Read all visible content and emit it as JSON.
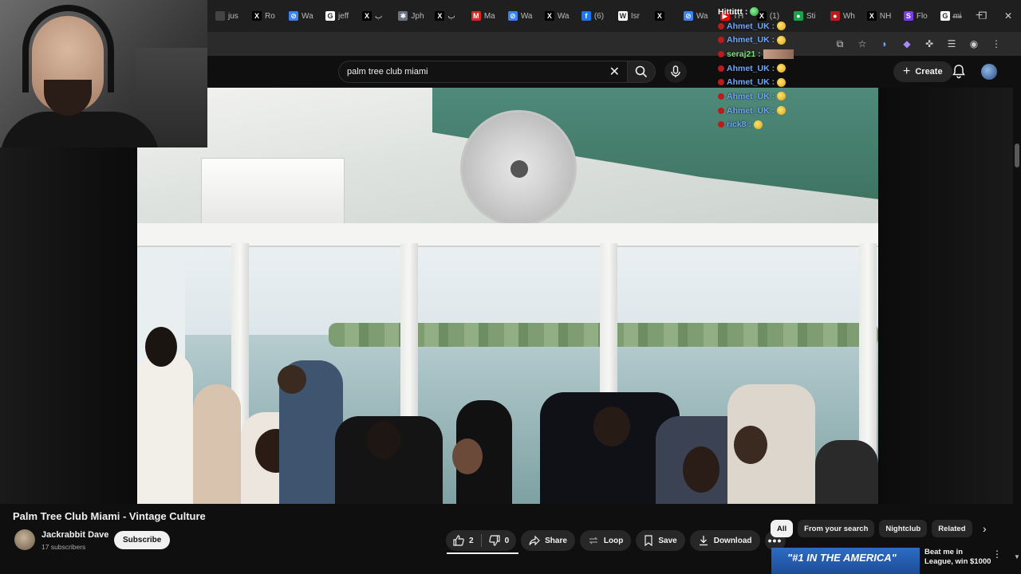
{
  "browser": {
    "tabs": [
      {
        "label": "jus",
        "icon": "page-icon",
        "color": "#444444",
        "glyph": ""
      },
      {
        "label": "Ro",
        "icon": "x-icon",
        "color": "#000000",
        "glyph": "X"
      },
      {
        "label": "Wa",
        "icon": "grok-icon",
        "color": "#3b82f6",
        "glyph": "⊘"
      },
      {
        "label": "jeff",
        "icon": "google-icon",
        "color": "#ffffff",
        "glyph": "G"
      },
      {
        "label": "ب",
        "icon": "x-icon",
        "color": "#000000",
        "glyph": "X"
      },
      {
        "label": "Jph",
        "icon": "grok-icon",
        "color": "#6b7280",
        "glyph": "✱"
      },
      {
        "label": "ب",
        "icon": "x-icon",
        "color": "#000000",
        "glyph": "X"
      },
      {
        "label": "Ma",
        "icon": "gmail-icon",
        "color": "#dc2626",
        "glyph": "M"
      },
      {
        "label": "Wa",
        "icon": "grok-icon",
        "color": "#3b82f6",
        "glyph": "⊘"
      },
      {
        "label": "Wa",
        "icon": "x-icon",
        "color": "#000000",
        "glyph": "X"
      },
      {
        "label": "(6)",
        "icon": "facebook-icon",
        "color": "#1877f2",
        "glyph": "f"
      },
      {
        "label": "Isr",
        "icon": "wikipedia-icon",
        "color": "#ffffff",
        "glyph": "W"
      },
      {
        "label": "",
        "icon": "x-icon",
        "color": "#000000",
        "glyph": "X"
      },
      {
        "label": "Wa",
        "icon": "grok-icon",
        "color": "#3b82f6",
        "glyph": "⊘"
      },
      {
        "label": "TH",
        "icon": "youtube-icon",
        "color": "#ff0000",
        "glyph": "▶"
      },
      {
        "label": "(1)",
        "icon": "x-icon",
        "color": "#000000",
        "glyph": "X"
      },
      {
        "label": "Sti",
        "icon": "globe-icon",
        "color": "#16a34a",
        "glyph": "●"
      },
      {
        "label": "Wh",
        "icon": "globe-icon",
        "color": "#b91c1c",
        "glyph": "●"
      },
      {
        "label": "NH",
        "icon": "x-icon",
        "color": "#000000",
        "glyph": "X"
      },
      {
        "label": "Flo",
        "icon": "s-icon",
        "color": "#7c3aed",
        "glyph": "S"
      },
      {
        "label": "mi",
        "icon": "google-icon",
        "color": "#ffffff",
        "glyph": "G"
      }
    ],
    "new_tab": "+"
  },
  "youtube": {
    "search_value": "palm tree club miami",
    "create_label": "Create"
  },
  "chat": [
    {
      "name": "Hittittt :",
      "style": "white",
      "emote": "green"
    },
    {
      "name": "Ahmet_UK :",
      "style": "blue",
      "emote": "yellow"
    },
    {
      "name": "Ahmet_UK :",
      "style": "blue",
      "emote": "yellow"
    },
    {
      "name": "seraj21 :",
      "style": "green",
      "emote": "image"
    },
    {
      "name": "Ahmet_UK :",
      "style": "blue",
      "emote": "yellow"
    },
    {
      "name": "Ahmet_UK :",
      "style": "blue",
      "emote": "yellow"
    },
    {
      "name": "Ahmet_UK :",
      "style": "blue",
      "emote": "yellow"
    },
    {
      "name": "Ahmet_UK :",
      "style": "blue",
      "emote": "yellow"
    },
    {
      "name": "rick8 :",
      "style": "blue",
      "emote": "yellow"
    }
  ],
  "video": {
    "title": "Palm Tree Club Miami - Vintage Culture",
    "channel_name": "Jackrabbit Dave",
    "subscribers": "17 subscribers",
    "subscribe_label": "Subscribe",
    "likes": "2",
    "dislikes": "0",
    "share_label": "Share",
    "loop_label": "Loop",
    "save_label": "Save",
    "download_label": "Download"
  },
  "chips": [
    "All",
    "From your search",
    "Nightclub",
    "Related"
  ],
  "recommendation": {
    "thumb_text": "\"#1 IN THE AMERICA\"",
    "title": "Beat me in League, win $1000"
  }
}
